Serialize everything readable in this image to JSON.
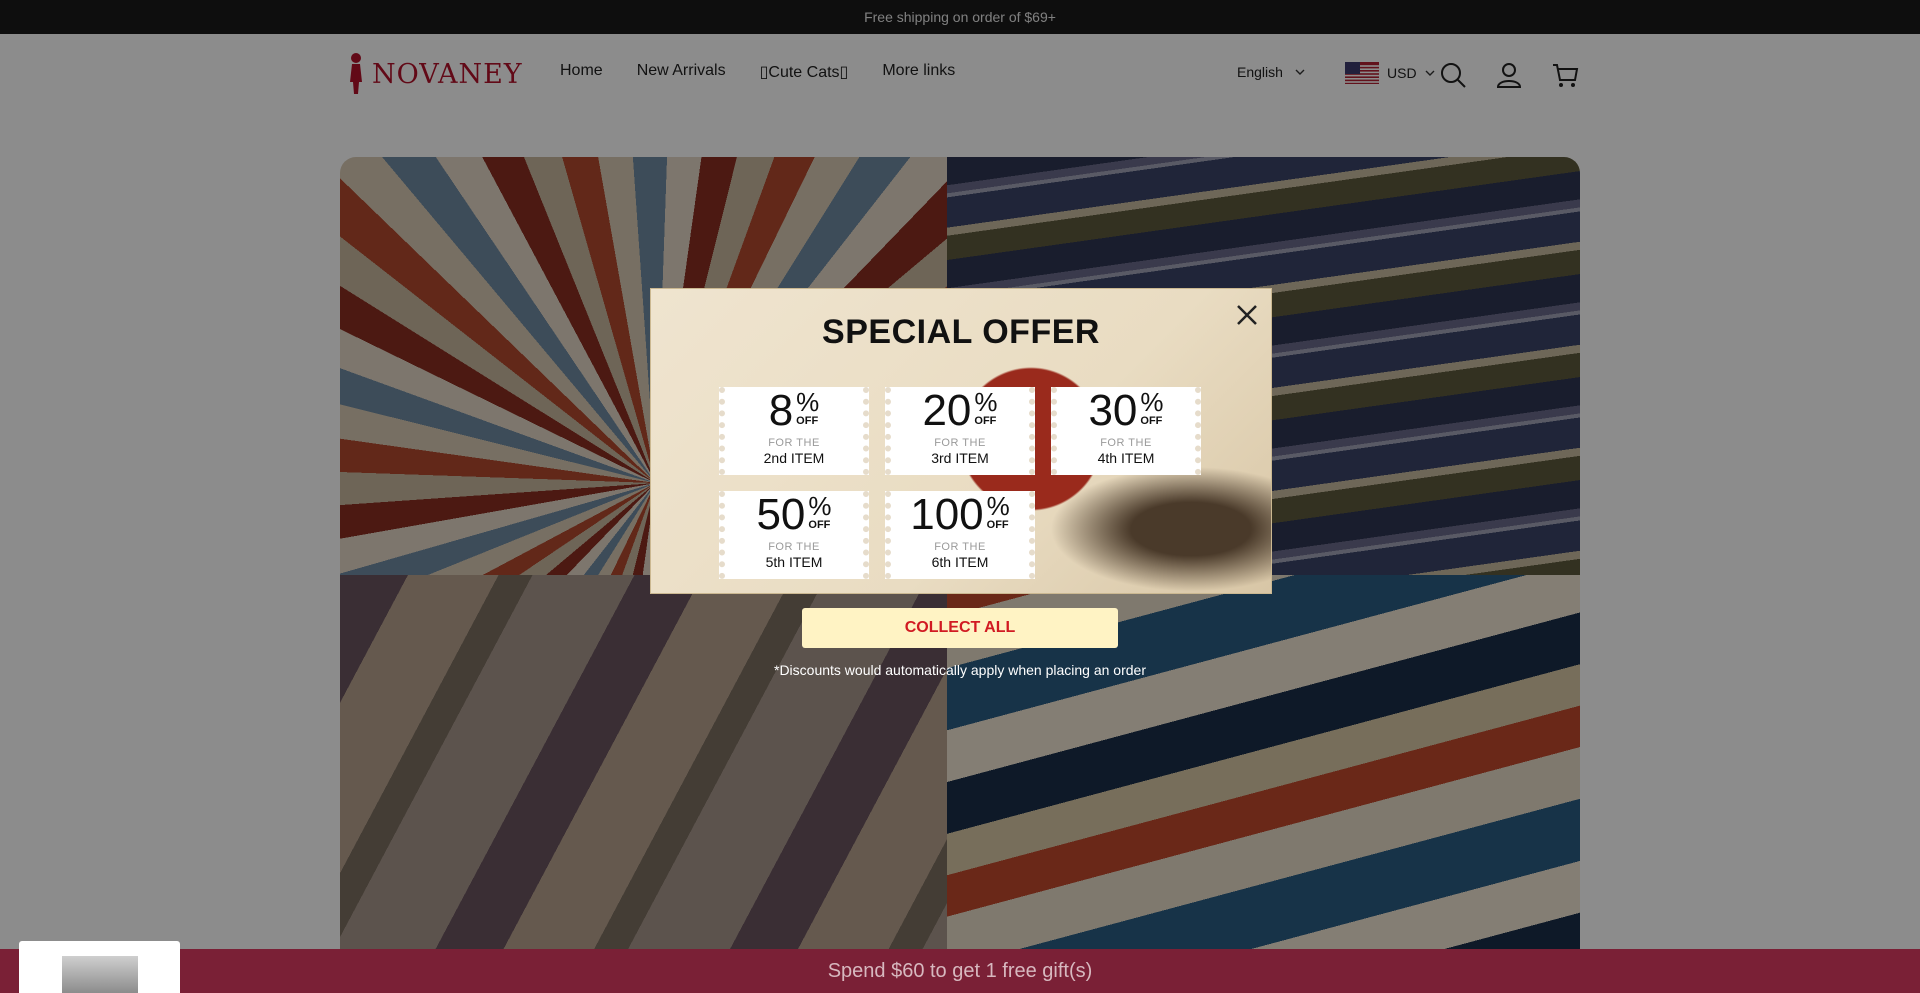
{
  "announcement": "Free shipping on order of $69+",
  "brand": {
    "name": "NOVANEY"
  },
  "nav": [
    "Home",
    "New Arrivals",
    "▯Cute Cats▯",
    "More links"
  ],
  "language": "English",
  "currency": "USD",
  "icons": [
    "search-icon",
    "account-icon",
    "cart-icon",
    "close-icon",
    "chevron-down-icon",
    "us-flag-icon"
  ],
  "popup": {
    "title": "SPECIAL OFFER",
    "offers": [
      {
        "value": "8",
        "percent": "%",
        "off": "OFF",
        "for": "FOR THE",
        "item": "2nd ITEM"
      },
      {
        "value": "20",
        "percent": "%",
        "off": "OFF",
        "for": "FOR THE",
        "item": "3rd ITEM"
      },
      {
        "value": "30",
        "percent": "%",
        "off": "OFF",
        "for": "FOR THE",
        "item": "4th ITEM"
      },
      {
        "value": "50",
        "percent": "%",
        "off": "OFF",
        "for": "FOR THE",
        "item": "5th ITEM"
      },
      {
        "value": "100",
        "percent": "%",
        "off": "OFF",
        "for": "FOR THE",
        "item": "6th ITEM"
      }
    ],
    "collect_label": "COLLECT ALL",
    "note": "*Discounts would automatically apply when placing an order"
  },
  "gift_bar": "Spend $60 to get 1 free gift(s)",
  "colors": {
    "brand": "#b3122a",
    "collect_bg": "#fff3c4",
    "collect_text": "#d11a22",
    "gift_bar": "#7a2036"
  }
}
